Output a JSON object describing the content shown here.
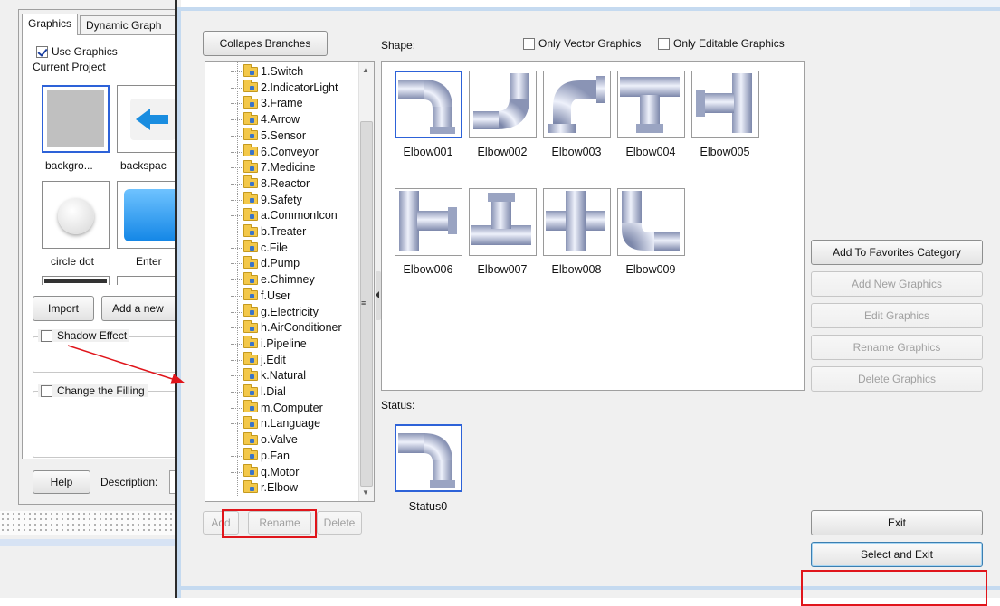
{
  "background_window": {
    "tabs": [
      "Graphics",
      "Dynamic Graph"
    ],
    "use_graphics_label": "Use Graphics",
    "use_graphics_checked": true,
    "current_project_label": "Current Project",
    "thumbnails": [
      {
        "label": "backgro..."
      },
      {
        "label": "backspac"
      },
      {
        "label": "circle dot"
      },
      {
        "label": "Enter"
      }
    ],
    "import_button": "Import",
    "add_new_button": "Add a new",
    "shadow_effect_label": "Shadow Effect",
    "change_filling_label": "Change the Filling",
    "help_button": "Help",
    "description_label": "Description:"
  },
  "dialog": {
    "collapse_button": "Collapes Branches",
    "shape_label": "Shape:",
    "only_vector_label": "Only Vector Graphics",
    "only_editable_label": "Only Editable Graphics",
    "tree_items": [
      "1.Switch",
      "2.IndicatorLight",
      "3.Frame",
      "4.Arrow",
      "5.Sensor",
      "6.Conveyor",
      "7.Medicine",
      "8.Reactor",
      "9.Safety",
      "a.CommonIcon",
      "b.Treater",
      "c.File",
      "d.Pump",
      "e.Chimney",
      "f.User",
      "g.Electricity",
      "h.AirConditioner",
      "i.Pipeline",
      "j.Edit",
      "k.Natural",
      "l.Dial",
      "m.Computer",
      "n.Language",
      "o.Valve",
      "p.Fan",
      "q.Motor",
      "r.Elbow"
    ],
    "tree_selected": "r.Elbow",
    "shapes": [
      "Elbow001",
      "Elbow002",
      "Elbow003",
      "Elbow004",
      "Elbow005",
      "Elbow006",
      "Elbow007",
      "Elbow008",
      "Elbow009"
    ],
    "shape_selected": "Elbow001",
    "status_label": "Status:",
    "status_items": [
      "Status0"
    ],
    "buttons": {
      "add_favorites": "Add To Favorites Category",
      "add_new_graphics": "Add New Graphics",
      "edit_graphics": "Edit Graphics",
      "rename_graphics": "Rename Graphics",
      "delete_graphics": "Delete Graphics",
      "add": "Add",
      "rename": "Rename",
      "delete": "Delete",
      "exit": "Exit",
      "select_and_exit": "Select and Exit"
    }
  },
  "colors": {
    "annotation_red": "#e0151b",
    "selection_blue": "#2d62d8",
    "dialog_frame": "#c5daf0"
  }
}
